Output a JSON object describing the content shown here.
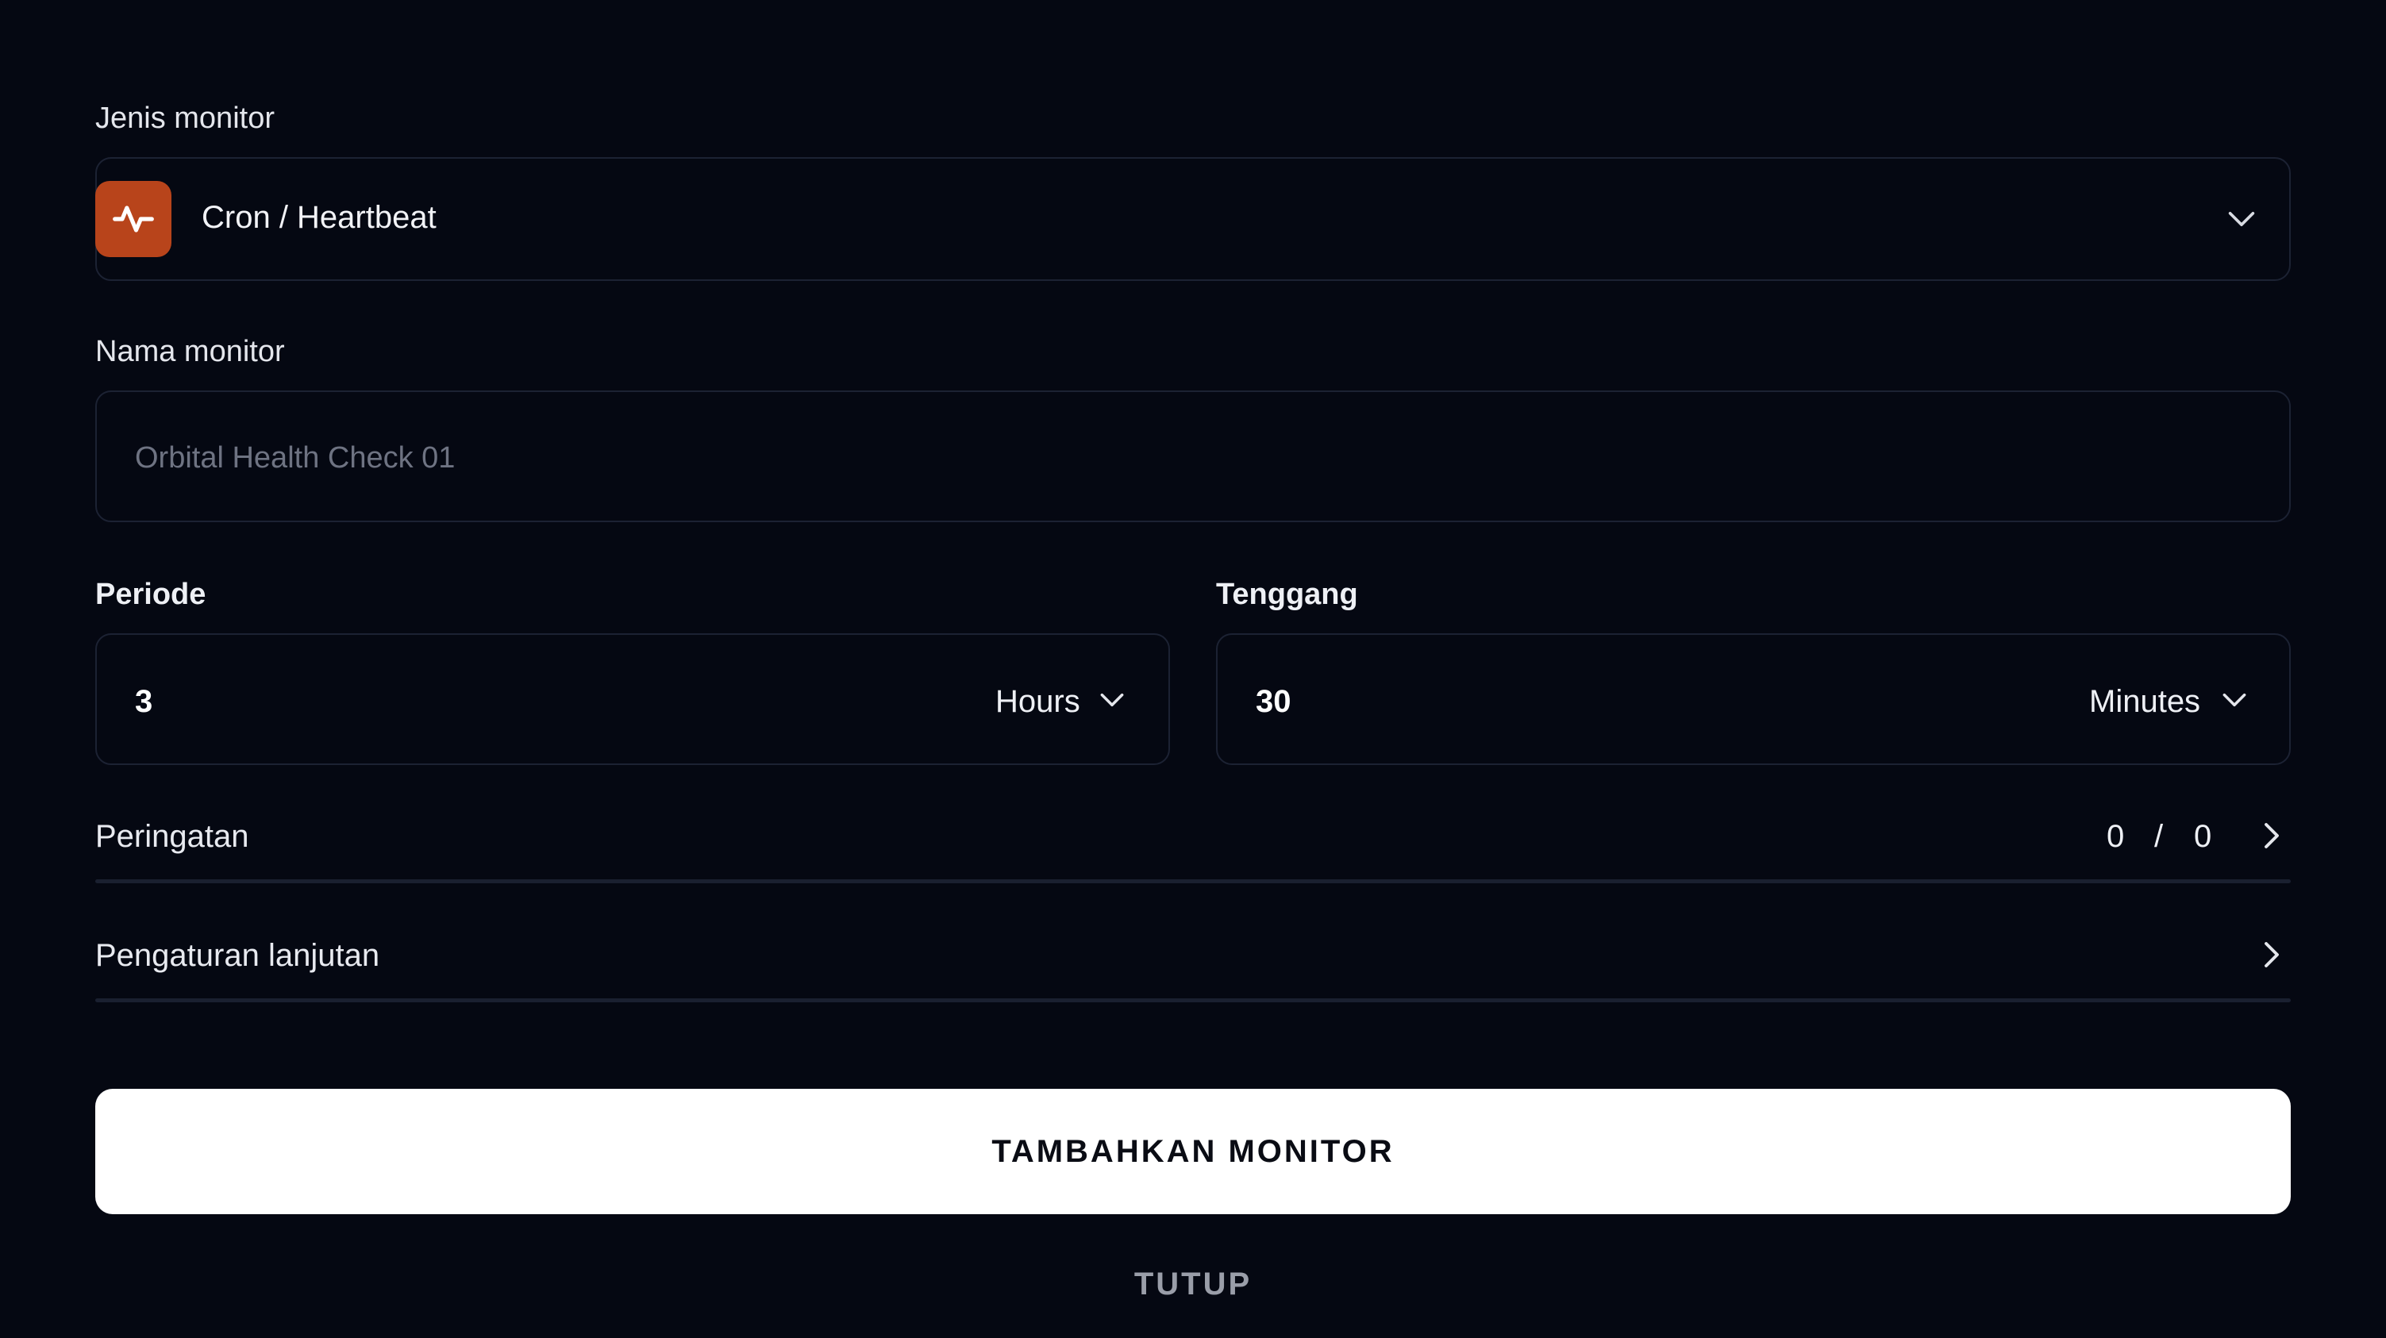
{
  "monitor_type": {
    "label": "Jenis monitor",
    "selected": "Cron / Heartbeat",
    "icon": "heartbeat-icon",
    "icon_color": "#b8441b"
  },
  "monitor_name": {
    "label": "Nama monitor",
    "placeholder": "Orbital Health Check 01",
    "value": ""
  },
  "period": {
    "label": "Periode",
    "value": "3",
    "unit": "Hours"
  },
  "grace": {
    "label": "Tenggang",
    "value": "30",
    "unit": "Minutes"
  },
  "alerts": {
    "label": "Peringatan",
    "count_left": "0",
    "separator": "/",
    "count_right": "0"
  },
  "advanced": {
    "label": "Pengaturan lanjutan"
  },
  "actions": {
    "submit_label": "TAMBAHKAN MONITOR",
    "close_label": "TUTUP"
  }
}
